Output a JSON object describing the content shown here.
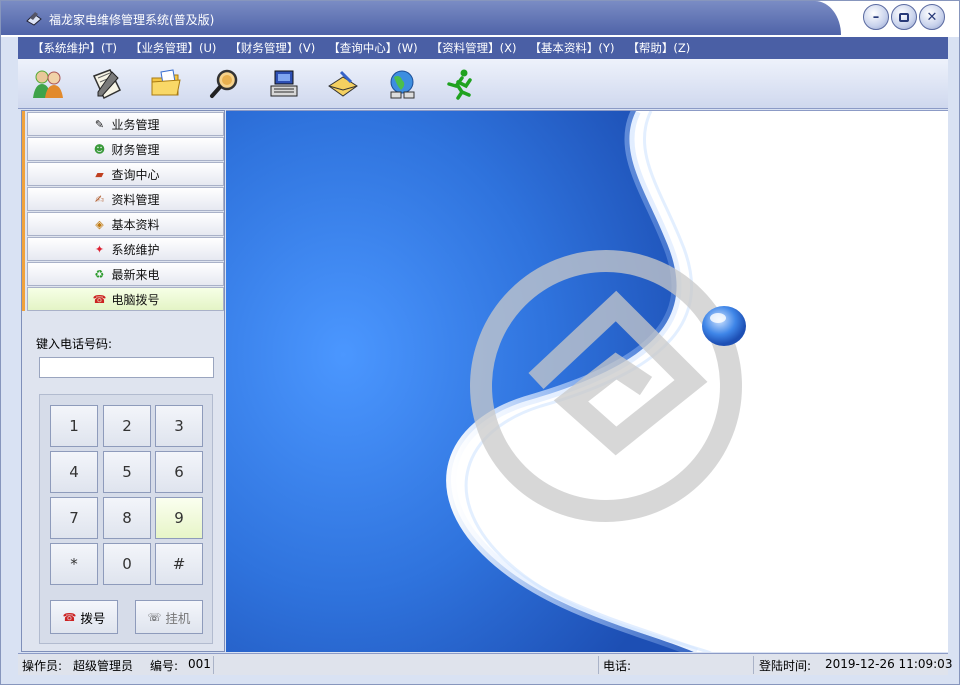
{
  "window": {
    "title": "福龙家电维修管理系统(普及版)",
    "controls": [
      "minimize",
      "restore",
      "close"
    ]
  },
  "menubar": {
    "items": [
      "【系统维护】(T)",
      "【业务管理】(U)",
      "【财务管理】(V)",
      "【查询中心】(W)",
      "【资料管理】(X)",
      "【基本资料】(Y)",
      "【帮助】(Z)"
    ]
  },
  "toolbar": {
    "buttons": [
      "users-icon",
      "notebook-icon",
      "folder-icon",
      "search-icon",
      "phone-icon",
      "mail-icon",
      "network-icon",
      "exit-runner-icon"
    ]
  },
  "sidebar": {
    "items": [
      {
        "label": "业务管理",
        "icon": "pencil-icon"
      },
      {
        "label": "财务管理",
        "icon": "users-icon"
      },
      {
        "label": "查询中心",
        "icon": "book-icon"
      },
      {
        "label": "资料管理",
        "icon": "notebook-icon"
      },
      {
        "label": "基本资料",
        "icon": "arrow-icon"
      },
      {
        "label": "系统维护",
        "icon": "tools-icon"
      },
      {
        "label": "最新来电",
        "icon": "recycle-icon"
      },
      {
        "label": "电脑拨号",
        "icon": "dial-icon"
      }
    ],
    "active_index": 7
  },
  "dialer": {
    "label": "键入电话号码:",
    "input_value": "",
    "keys": [
      "1",
      "2",
      "3",
      "4",
      "5",
      "6",
      "7",
      "8",
      "9",
      "*",
      "0",
      "#"
    ],
    "highlighted_key": "9",
    "dial_label": "拨号",
    "hangup_label": "挂机"
  },
  "statusbar": {
    "operator_label": "操作员:",
    "operator_value": "超级管理员",
    "id_label": "编号:",
    "id_value": "001",
    "phone_label": "电话:",
    "phone_value": "",
    "login_label": "登陆时间:",
    "login_value": "2019-12-26 11:09:03"
  },
  "colors": {
    "menubar": "#4a5fa5",
    "title_gradient_top": "#7a8cc4",
    "background_blue": "#2f6fd3",
    "active_nav": "#e4f4c6",
    "accent_orange": "#f0a23c"
  }
}
